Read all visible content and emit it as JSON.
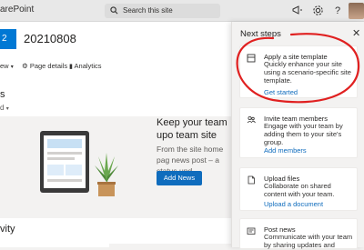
{
  "suite": {
    "brand": "arePoint",
    "search_placeholder": "Search this site"
  },
  "site": {
    "logo_text": "2",
    "title": "20210808"
  },
  "commandbar": {
    "new_label": "ew",
    "page_details_label": "Page details",
    "analytics_label": "Analytics"
  },
  "sections": {
    "news_title": "s",
    "news_sub": "d",
    "keep_title": "Keep your team upo team site",
    "keep_body": "From the site home pag news post – a status upd",
    "add_news_label": "Add News",
    "activity_title": "vity"
  },
  "panel": {
    "title": "Next steps",
    "steps": [
      {
        "title": "Apply a site template",
        "desc": "Quickly enhance your site using a scenario-specific site template.",
        "link": "Get started"
      },
      {
        "title": "Invite team members",
        "desc": "Engage with your team by adding them to your site's group.",
        "link": "Add members"
      },
      {
        "title": "Upload files",
        "desc": "Collaborate on shared content with your team.",
        "link": "Upload a document"
      },
      {
        "title": "Post news",
        "desc": "Communicate with your team by sharing updates and",
        "link": ""
      }
    ]
  },
  "colors": {
    "accent": "#0f6cbd",
    "annotation": "#e02020"
  }
}
